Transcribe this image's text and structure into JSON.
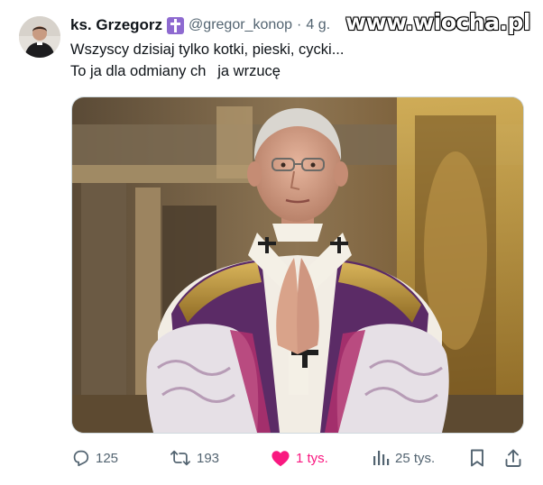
{
  "tweet": {
    "display_name": "ks. Grzegorz",
    "handle": "@gregor_konop",
    "separator": "·",
    "time": "4 g.",
    "badge_icon": "cross-icon",
    "text_line1": "Wszyscy dzisiaj tylko kotki, pieski, cycki...",
    "text_line2": "To ja dla odmiany ch  ja wrzucę",
    "media_description_icon": "photo",
    "watermark": "www.wiocha.pl"
  },
  "actions": {
    "reply_count": "125",
    "retweet_count": "193",
    "like_count": "1 tys.",
    "views_count": "25 tys."
  },
  "colors": {
    "like": "#f91880",
    "secondary_text": "#536471",
    "badge": "#8e6ad0",
    "primary_text": "#0f1419"
  }
}
